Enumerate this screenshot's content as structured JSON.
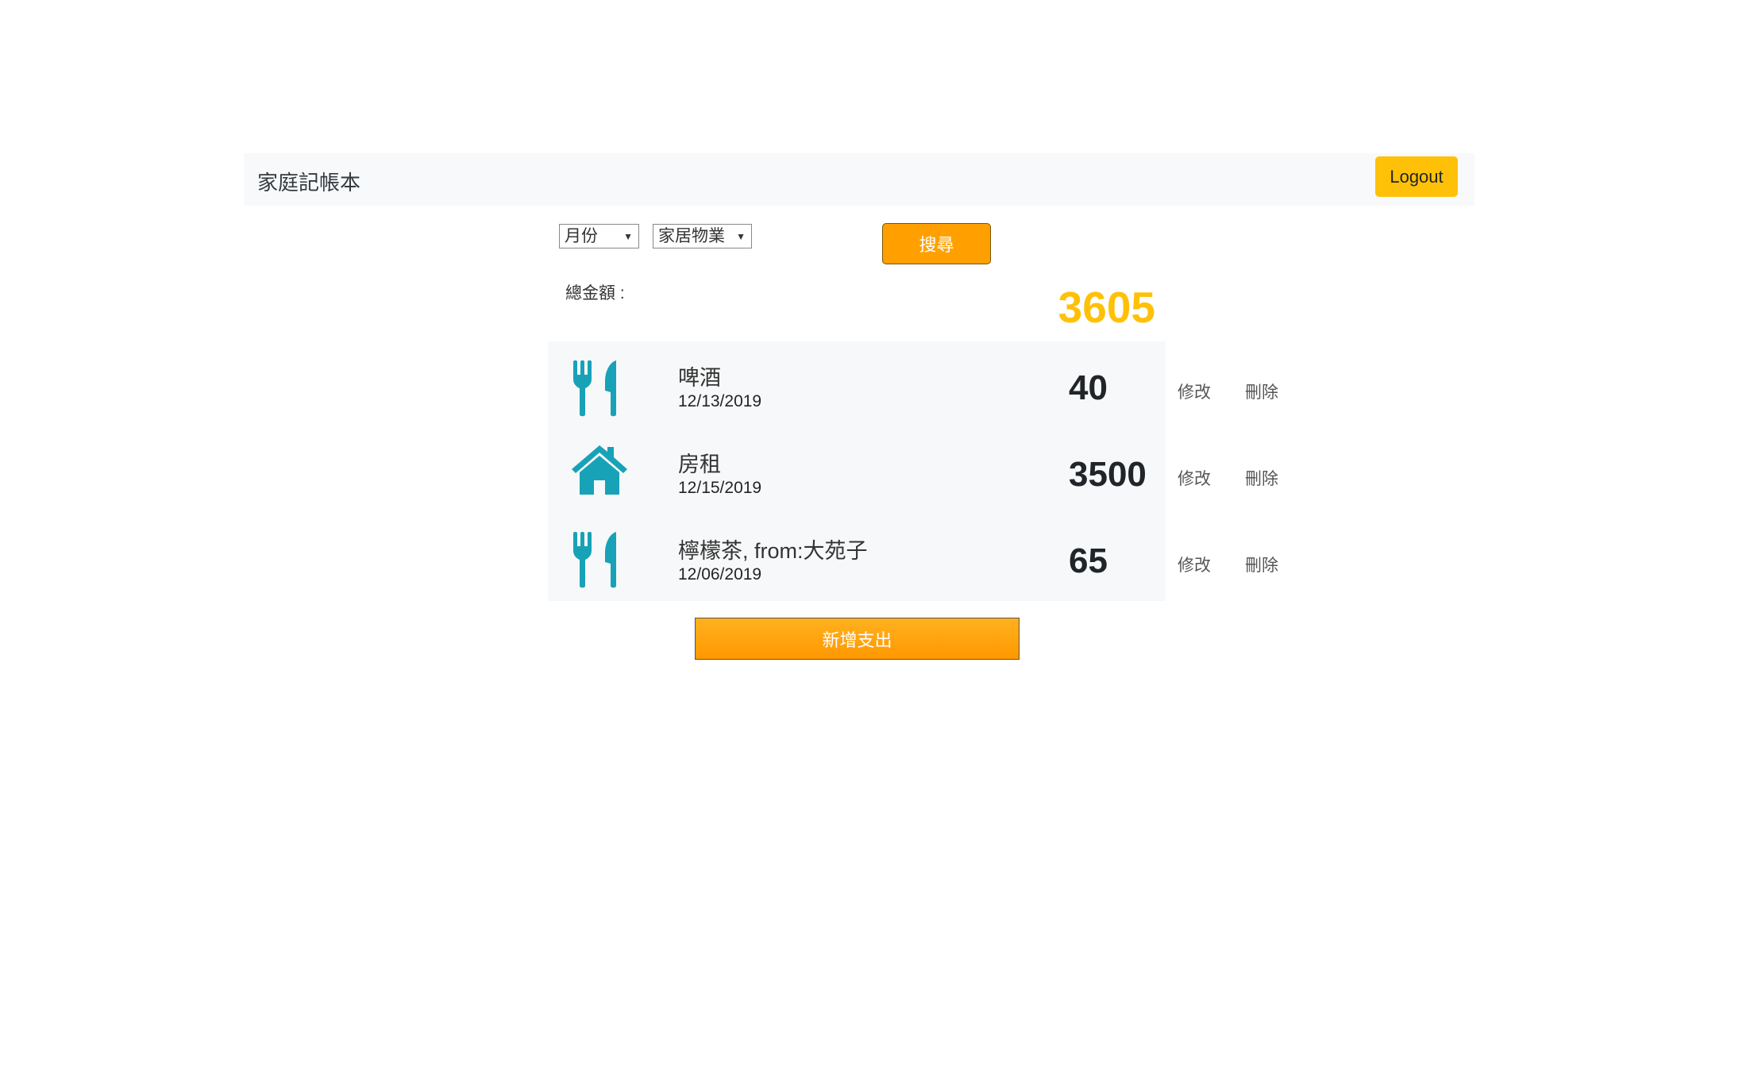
{
  "navbar": {
    "brand": "家庭記帳本",
    "logout_label": "Logout"
  },
  "filters": {
    "month": {
      "selected": "月份"
    },
    "category": {
      "selected": "家居物業"
    },
    "search_label": "搜尋"
  },
  "summary": {
    "total_label": "總金額 :",
    "total_value": "3605"
  },
  "colors": {
    "accent": "#ffc107",
    "button": "#ffa000",
    "icon": "#17a2b8"
  },
  "entries": [
    {
      "icon": "utensils-icon",
      "name": "啤酒",
      "date": "12/13/2019",
      "amount": "40",
      "edit_label": "修改",
      "delete_label": "刪除"
    },
    {
      "icon": "house-icon",
      "name": "房租",
      "date": "12/15/2019",
      "amount": "3500",
      "edit_label": "修改",
      "delete_label": "刪除"
    },
    {
      "icon": "utensils-icon",
      "name": "檸檬茶, from:大苑子",
      "date": "12/06/2019",
      "amount": "65",
      "edit_label": "修改",
      "delete_label": "刪除"
    }
  ],
  "add_label": "新增支出"
}
